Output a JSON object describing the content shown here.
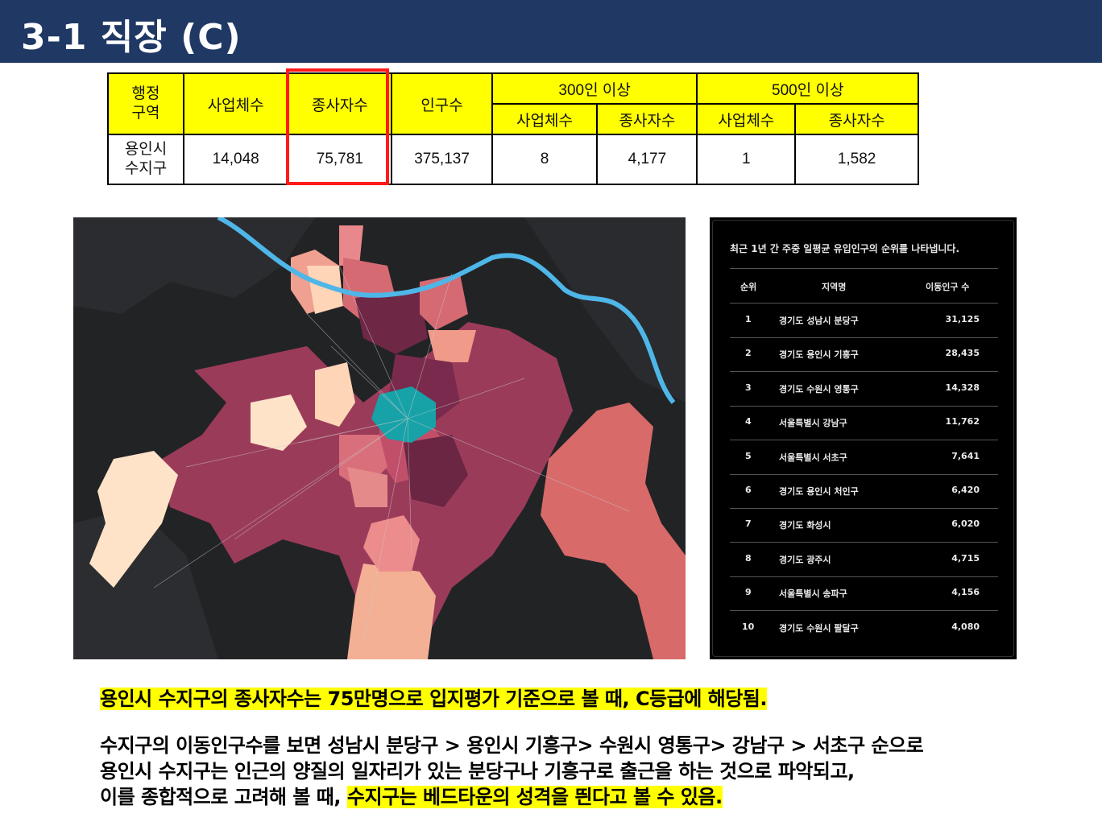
{
  "header": {
    "title": "3-1 직장 (C)"
  },
  "table": {
    "headers": {
      "region": "행정\n구역",
      "businesses": "사업체수",
      "employees": "종사자수",
      "population": "인구수",
      "group300": "300인 이상",
      "group500": "500인 이상",
      "sub_businesses": "사업체수",
      "sub_employees": "종사자수"
    },
    "row": {
      "region": "용인시\n수지구",
      "businesses": "14,048",
      "employees": "75,781",
      "population": "375,137",
      "b300": "8",
      "e300": "4,177",
      "b500": "1",
      "e500": "1,582"
    }
  },
  "ranking": {
    "caption": "최근 1년 간 주중 일평균 유입인구의 순위를 나타냅니다.",
    "columns": [
      "순위",
      "지역명",
      "이동인구 수"
    ],
    "rows": [
      {
        "rank": "1",
        "region": "경기도 성남시 분당구",
        "count": "31,125"
      },
      {
        "rank": "2",
        "region": "경기도 용인시 기흥구",
        "count": "28,435"
      },
      {
        "rank": "3",
        "region": "경기도 수원시 영통구",
        "count": "14,328"
      },
      {
        "rank": "4",
        "region": "서울특별시 강남구",
        "count": "11,762"
      },
      {
        "rank": "5",
        "region": "서울특별시 서초구",
        "count": "7,641"
      },
      {
        "rank": "6",
        "region": "경기도 용인시 처인구",
        "count": "6,420"
      },
      {
        "rank": "7",
        "region": "경기도 화성시",
        "count": "6,020"
      },
      {
        "rank": "8",
        "region": "경기도 광주시",
        "count": "4,715"
      },
      {
        "rank": "9",
        "region": "서울특별시 송파구",
        "count": "4,156"
      },
      {
        "rank": "10",
        "region": "경기도 수원시 팔달구",
        "count": "4,080"
      }
    ]
  },
  "summary": {
    "line1": "용인시 수지구의 종사자수는 75만명으로 입지평가 기준으로 볼 때, C등급에 해당됨.",
    "line2": "수지구의 이동인구수를 보면 성남시 분당구 > 용인시 기흥구> 수원시 영통구> 강남구 > 서초구 순으로",
    "line3": "용인시 수지구는 인근의 양질의 일자리가 있는 분당구나 기흥구로 출근을 하는 것으로 파악되고,",
    "line4_plain": "이를 종합적으로 고려해 볼 때, ",
    "line4_highlight": "수지구는 베드타운의 성격을 띈다고 볼 수 있음."
  },
  "colors": {
    "header_bg": "#1f3864",
    "table_header": "#ffff00",
    "highlight_box": "#ff1a1a",
    "map_focus": "#17a2a8"
  }
}
